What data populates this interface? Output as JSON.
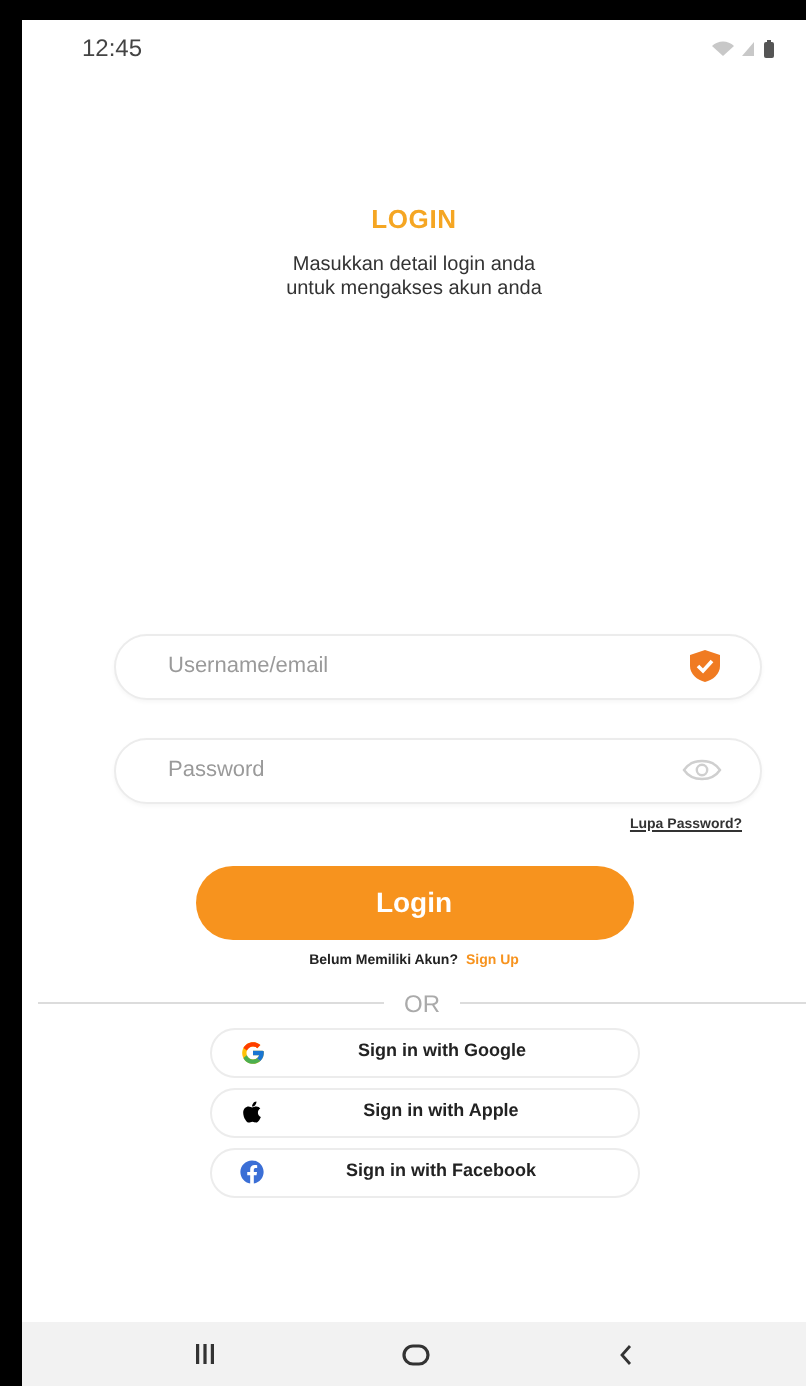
{
  "status_bar": {
    "time": "12:45"
  },
  "title": "LOGIN",
  "subtitle": "Masukkan detail login anda\nuntuk mengakses akun anda",
  "fields": [
    {
      "kind": "username",
      "placeholder": "Username/email"
    },
    {
      "kind": "password",
      "placeholder": "Password"
    }
  ],
  "forgot_link": "Lupa Password?",
  "login_button": "Login",
  "signup": {
    "prompt": "Belum Memiliki Akun?",
    "link": "Sign Up"
  },
  "divider": "OR",
  "social_buttons": [
    {
      "kind": "google",
      "label": "Sign in with Google"
    },
    {
      "kind": "apple",
      "label": "Sign in with Apple"
    },
    {
      "kind": "facebook",
      "label": "Sign in with Facebook"
    }
  ]
}
